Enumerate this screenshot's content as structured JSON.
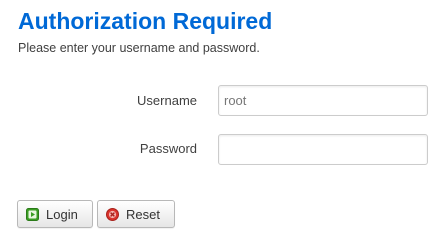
{
  "header": {
    "title": "Authorization Required",
    "subtitle": "Please enter your username and password."
  },
  "form": {
    "username_label": "Username",
    "username_value": "root",
    "password_label": "Password",
    "password_value": ""
  },
  "actions": {
    "login_label": "Login",
    "login_icon": "login-apply-icon",
    "reset_label": "Reset",
    "reset_icon": "reset-cancel-icon"
  },
  "colors": {
    "title": "#0069d6",
    "login_icon_green": "#3a9d23",
    "reset_icon_red": "#d9322b"
  }
}
